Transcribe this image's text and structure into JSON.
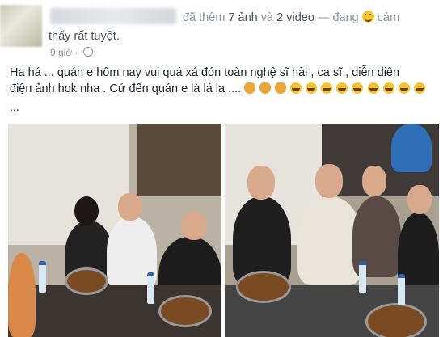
{
  "header": {
    "added_text": "đã thêm",
    "photos": "7 ảnh",
    "and": "và",
    "videos": "2 video",
    "feeling_prefix": "— đang",
    "feeling_word": "cảm",
    "feeling_line2": "thấy rất tuyệt.",
    "time": "9 giờ ·"
  },
  "post": {
    "line1": "Ha há ... quán e hôm nay vui quá xá đón toàn nghệ sĩ hài , ca sĩ , diễn diên",
    "line2": "điện ảnh hok nha . Cứ đến quán e là lá la ....",
    "ellipsis": "..."
  },
  "icons": {
    "emoji_face": "laughing-face-icon",
    "privacy": "globe-icon",
    "hands": "clapping-hands-icon",
    "laugh": "rolling-laughing-icon"
  },
  "colors": {
    "meta_gray": "#90949c",
    "text": "#1d2129"
  }
}
